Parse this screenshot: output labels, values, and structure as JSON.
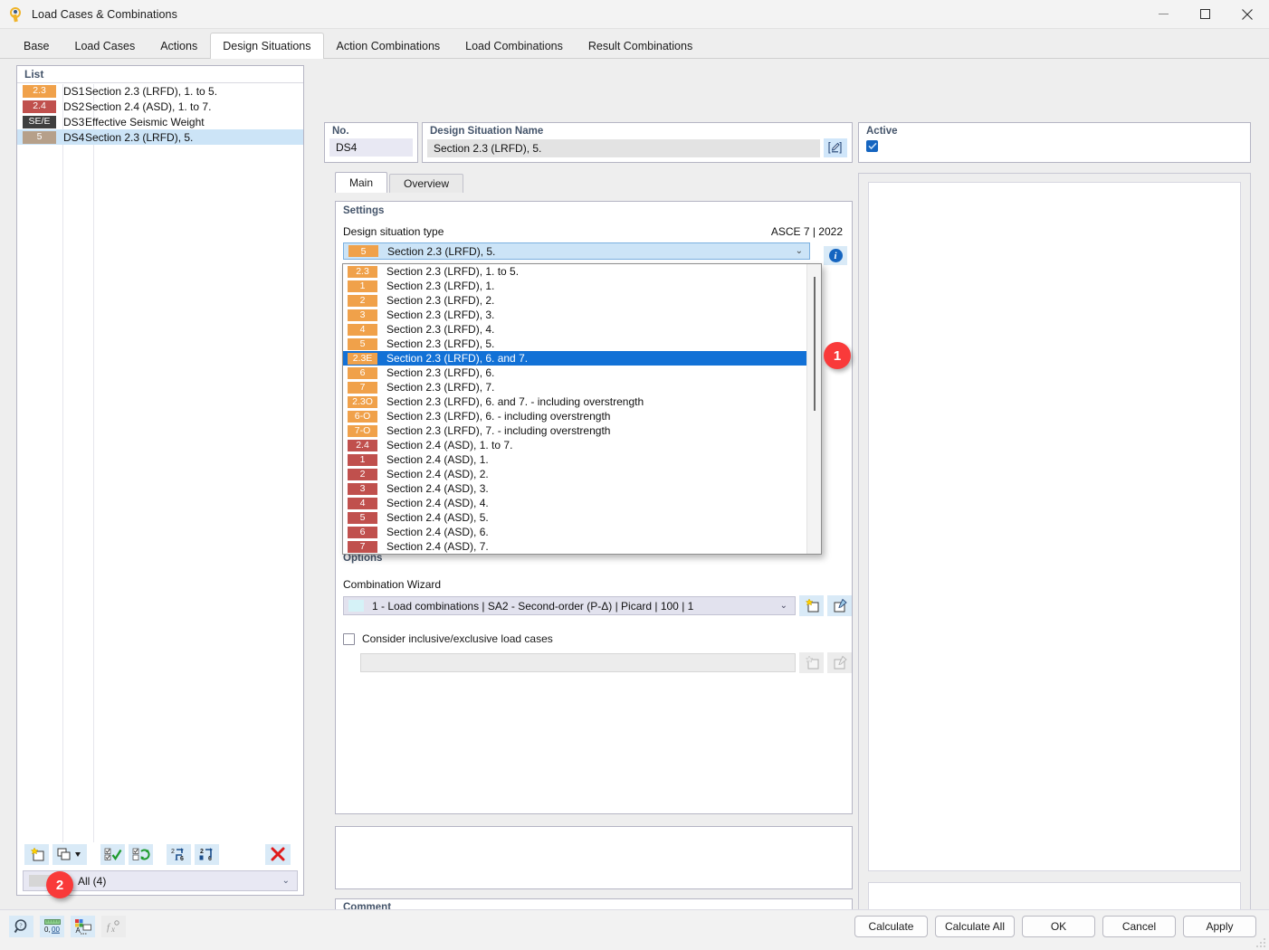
{
  "window": {
    "title": "Load Cases & Combinations",
    "icon": "app-logo-icon",
    "minimize": "—",
    "maximize": "▢",
    "close": "✕"
  },
  "tabs": [
    {
      "label": "Base",
      "active": false
    },
    {
      "label": "Load Cases",
      "active": false
    },
    {
      "label": "Actions",
      "active": false
    },
    {
      "label": "Design Situations",
      "active": true
    },
    {
      "label": "Action Combinations",
      "active": false
    },
    {
      "label": "Load Combinations",
      "active": false
    },
    {
      "label": "Result Combinations",
      "active": false
    }
  ],
  "list": {
    "header": "List",
    "rows": [
      {
        "badge": "2.3",
        "badge_color": "#f0a14a",
        "no": "DS1",
        "name": "Section 2.3 (LRFD), 1. to 5.",
        "selected": false
      },
      {
        "badge": "2.4",
        "badge_color": "#c0504d",
        "no": "DS2",
        "name": "Section 2.4 (ASD), 1. to 7.",
        "selected": false
      },
      {
        "badge": "SE/E",
        "badge_color": "#3f3f3f",
        "no": "DS3",
        "name": "Effective Seismic Weight",
        "selected": false
      },
      {
        "badge": "5",
        "badge_color": "#b6a08a",
        "no": "DS4",
        "name": "Section 2.3 (LRFD), 5.",
        "selected": true
      }
    ],
    "toolbar": [
      {
        "name": "new-design-situation-button",
        "icon": "new-item-icon"
      },
      {
        "name": "copy-design-situation-button",
        "icon": "copy-item-dropdown-icon"
      },
      {
        "name": "select-all-button",
        "icon": "check-all-icon"
      },
      {
        "name": "invert-selection-button",
        "icon": "invert-selection-icon"
      },
      {
        "name": "renumber-button",
        "icon": "renumber-icon"
      },
      {
        "name": "renumber-sequential-button",
        "icon": "renumber-sequential-icon"
      },
      {
        "name": "delete-button",
        "icon": "delete-x-icon"
      }
    ],
    "filter": {
      "label": "All (4)",
      "arrow": "⌄"
    }
  },
  "form": {
    "no_label": "No.",
    "no_value": "DS4",
    "name_label": "Design Situation Name",
    "name_value": "Section 2.3 (LRFD), 5.",
    "edit_icon": "edit-pencil-icon",
    "active_label": "Active",
    "active_checked": true,
    "check_glyph": "✓"
  },
  "inner_tabs": [
    {
      "label": "Main",
      "active": true
    },
    {
      "label": "Overview",
      "active": false
    }
  ],
  "settings": {
    "title": "Settings",
    "design_situation_type_label": "Design situation type",
    "standard": "ASCE 7 | 2022",
    "selected": {
      "badge": "5",
      "badge_color": "#f0a14a",
      "text": "Section 2.3 (LRFD), 5."
    },
    "arrow": "⌄",
    "info_icon": "info-icon",
    "info_glyph": "i"
  },
  "dropdown": {
    "items": [
      {
        "badge": "2.3",
        "badge_color": "#f0a14a",
        "text": "Section 2.3 (LRFD), 1. to 5.",
        "highlighted": false
      },
      {
        "badge": "1",
        "badge_color": "#f0a14a",
        "text": "Section 2.3 (LRFD), 1.",
        "highlighted": false
      },
      {
        "badge": "2",
        "badge_color": "#f0a14a",
        "text": "Section 2.3 (LRFD), 2.",
        "highlighted": false
      },
      {
        "badge": "3",
        "badge_color": "#f0a14a",
        "text": "Section 2.3 (LRFD), 3.",
        "highlighted": false
      },
      {
        "badge": "4",
        "badge_color": "#f0a14a",
        "text": "Section 2.3 (LRFD), 4.",
        "highlighted": false
      },
      {
        "badge": "5",
        "badge_color": "#f0a14a",
        "text": "Section 2.3 (LRFD), 5.",
        "highlighted": false
      },
      {
        "badge": "2.3E",
        "badge_color": "#f0a14a",
        "text": "Section 2.3 (LRFD), 6. and 7.",
        "highlighted": true
      },
      {
        "badge": "6",
        "badge_color": "#f0a14a",
        "text": "Section 2.3 (LRFD), 6.",
        "highlighted": false
      },
      {
        "badge": "7",
        "badge_color": "#f0a14a",
        "text": "Section 2.3 (LRFD), 7.",
        "highlighted": false
      },
      {
        "badge": "2.3O",
        "badge_color": "#f0a14a",
        "text": "Section 2.3 (LRFD), 6. and 7. - including overstrength",
        "highlighted": false
      },
      {
        "badge": "6-O",
        "badge_color": "#f0a14a",
        "text": "Section 2.3 (LRFD), 6. - including overstrength",
        "highlighted": false
      },
      {
        "badge": "7-O",
        "badge_color": "#f0a14a",
        "text": "Section 2.3 (LRFD), 7. - including overstrength",
        "highlighted": false
      },
      {
        "badge": "2.4",
        "badge_color": "#c0504d",
        "text": "Section 2.4 (ASD), 1. to 7.",
        "highlighted": false
      },
      {
        "badge": "1",
        "badge_color": "#c0504d",
        "text": "Section 2.4 (ASD), 1.",
        "highlighted": false
      },
      {
        "badge": "2",
        "badge_color": "#c0504d",
        "text": "Section 2.4 (ASD), 2.",
        "highlighted": false
      },
      {
        "badge": "3",
        "badge_color": "#c0504d",
        "text": "Section 2.4 (ASD), 3.",
        "highlighted": false
      },
      {
        "badge": "4",
        "badge_color": "#c0504d",
        "text": "Section 2.4 (ASD), 4.",
        "highlighted": false
      },
      {
        "badge": "5",
        "badge_color": "#c0504d",
        "text": "Section 2.4 (ASD), 5.",
        "highlighted": false
      },
      {
        "badge": "6",
        "badge_color": "#c0504d",
        "text": "Section 2.4 (ASD), 6.",
        "highlighted": false
      },
      {
        "badge": "7",
        "badge_color": "#c0504d",
        "text": "Section 2.4 (ASD), 7.",
        "highlighted": false
      }
    ]
  },
  "options": {
    "title": "Options",
    "combination_wizard_label": "Combination Wizard",
    "combination_wizard_value": "1 - Load combinations | SA2 - Second-order (P-Δ) | Picard | 100 | 1",
    "arrow": "⌄",
    "new_wizard_icon": "new-wizard-icon",
    "edit_wizard_icon": "edit-wizard-icon",
    "consider_label": "Consider inclusive/exclusive load cases",
    "consider_checked": false,
    "disabled_field_value": "",
    "new_disabled_icon": "new-item-icon",
    "edit_disabled_icon": "edit-item-icon"
  },
  "comment": {
    "label": "Comment",
    "value": "",
    "arrow": "⌄",
    "copy_icon": "copy-comment-icon"
  },
  "footer": {
    "icons": [
      {
        "name": "search-objects-icon",
        "label": "q"
      },
      {
        "name": "units-decimal-icon",
        "label": "0,00"
      },
      {
        "name": "display-properties-icon",
        "label": "A"
      },
      {
        "name": "formula-icon",
        "label": "fx"
      }
    ],
    "buttons": [
      {
        "label": "Calculate",
        "name": "calculate-button"
      },
      {
        "label": "Calculate All",
        "name": "calculate-all-button"
      },
      {
        "label": "OK",
        "name": "ok-button"
      },
      {
        "label": "Cancel",
        "name": "cancel-button"
      },
      {
        "label": "Apply",
        "name": "apply-button"
      }
    ]
  },
  "annotations": [
    {
      "number": "1"
    },
    {
      "number": "2"
    }
  ],
  "colors": {
    "accent_blue": "#1271d6",
    "selection_blue": "#cce4f7",
    "orange_badge": "#f0a14a",
    "red_badge": "#c0504d",
    "annotation_red": "#f93a3a",
    "label_blue": "#44546a"
  }
}
